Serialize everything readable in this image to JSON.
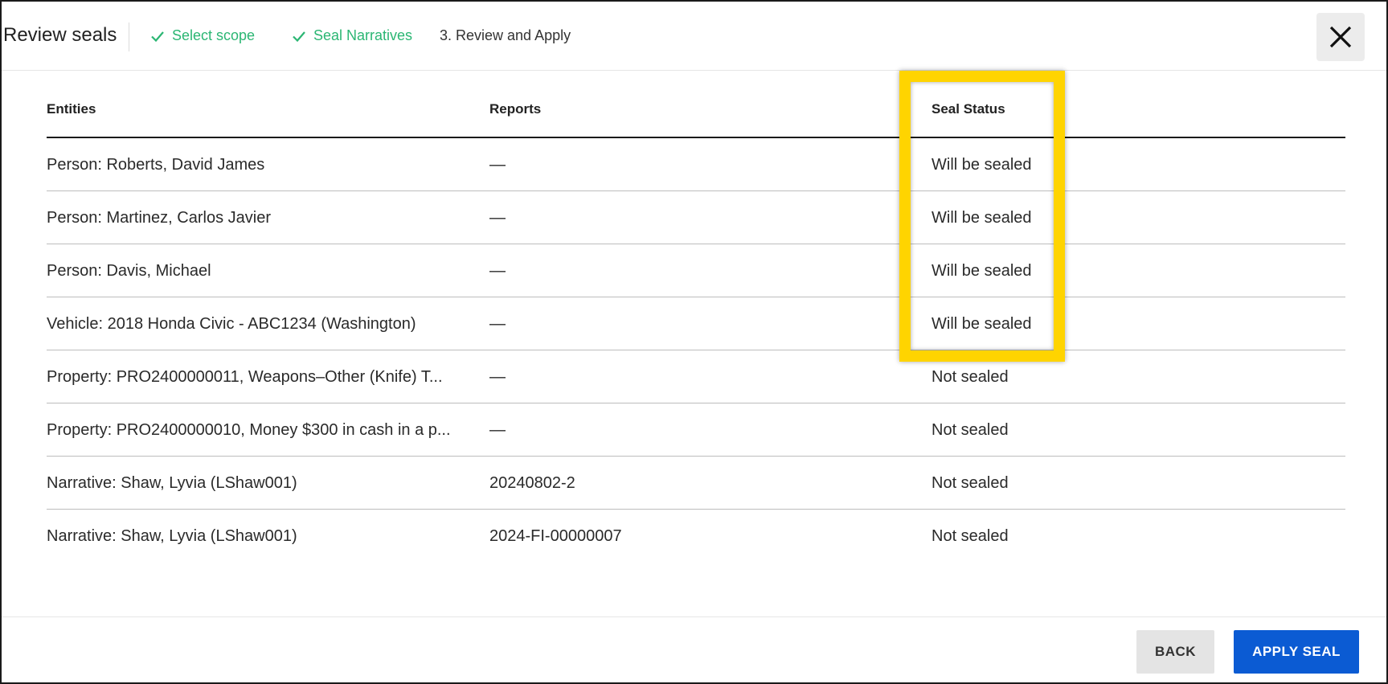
{
  "header": {
    "title": "Review seals",
    "steps": [
      {
        "label": "Select scope",
        "state": "done"
      },
      {
        "label": "Seal Narratives",
        "state": "done"
      },
      {
        "label": "3. Review and Apply",
        "state": "current"
      }
    ],
    "close_icon": "close-icon"
  },
  "table": {
    "columns": [
      "Entities",
      "Reports",
      "Seal Status"
    ],
    "rows": [
      {
        "entity": "Person: Roberts, David James",
        "report": "—",
        "status": "Will be sealed"
      },
      {
        "entity": "Person: Martinez, Carlos Javier",
        "report": "—",
        "status": "Will be sealed"
      },
      {
        "entity": "Person: Davis, Michael",
        "report": "—",
        "status": "Will be sealed"
      },
      {
        "entity": "Vehicle: 2018 Honda Civic - ABC1234 (Washington)",
        "report": "—",
        "status": "Will be sealed"
      },
      {
        "entity": "Property: PRO2400000011, Weapons–Other (Knife) T...",
        "report": "—",
        "status": "Not sealed"
      },
      {
        "entity": "Property: PRO2400000010, Money $300 in cash in a p...",
        "report": "—",
        "status": "Not sealed"
      },
      {
        "entity": "Narrative: Shaw, Lyvia (LShaw001)",
        "report": "20240802-2",
        "status": "Not sealed"
      },
      {
        "entity": "Narrative: Shaw, Lyvia (LShaw001)",
        "report": "2024-FI-00000007",
        "status": "Not sealed"
      }
    ]
  },
  "footer": {
    "back_label": "BACK",
    "apply_label": "APPLY SEAL"
  },
  "colors": {
    "step_done": "#2bb673",
    "primary": "#0b5bd3",
    "highlight": "#ffd400"
  }
}
